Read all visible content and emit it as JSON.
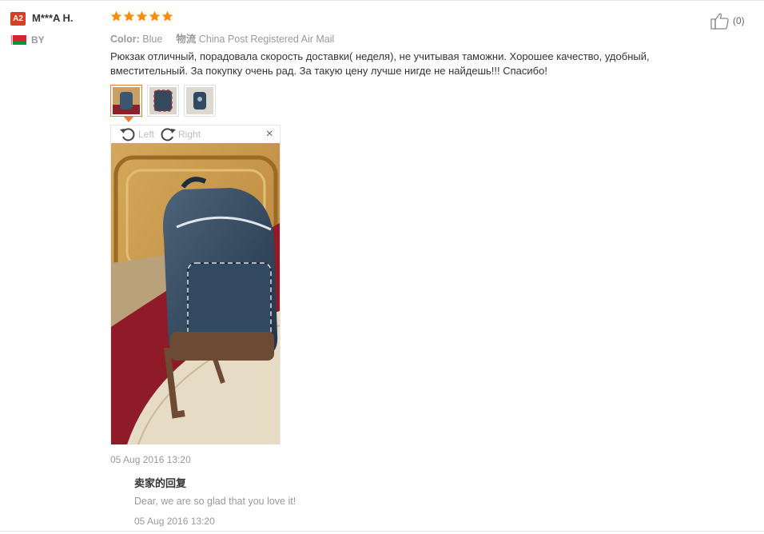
{
  "user": {
    "level_badge": "A2",
    "name": "M***A H.",
    "country": "BY"
  },
  "rating": {
    "stars": 5
  },
  "like": {
    "count": "(0)"
  },
  "meta": {
    "color_label": "Color:",
    "color_value": "Blue",
    "logistics_label": "物流",
    "logistics_value": "China Post Registered Air Mail"
  },
  "review": {
    "text": "Рюкзак отличный, порадовала скорость доставки( неделя), не учитывая таможни. Хорошее качество, удобный, вместительный. За покупку очень рад. За такую цену лучше нигде не найдешь!!! Спасибо!"
  },
  "viewer": {
    "rotate_left": "Left",
    "rotate_right": "Right",
    "close": "×"
  },
  "dates": {
    "review_date": "05 Aug 2016 13:20",
    "reply_date": "05 Aug 2016 13:20"
  },
  "reply": {
    "title": "卖家的回复",
    "text": "Dear, we are so glad that you love it!"
  },
  "colors": {
    "accent": "#f07a27",
    "star": "#ff8a00",
    "badge": "#d93e1e"
  }
}
